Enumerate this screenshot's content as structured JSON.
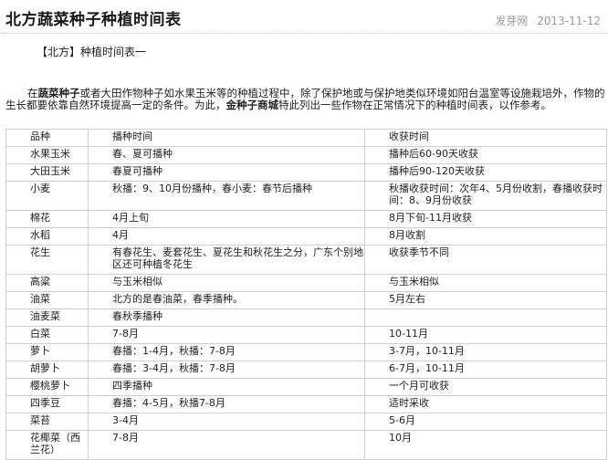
{
  "article": {
    "title": "北方蔬菜种子种植时间表",
    "source": "发芽网",
    "date": "2013-11-12",
    "subheading": "【北方】种植时间表一",
    "intro": {
      "p1": "在",
      "b1": "蔬菜种子",
      "p2": "或者大田作物种子如水果玉米等的种植过程中，除了保护地或与保护地类似环境如阳台温室等设施栽培外，作物的生长都要依靠自然环境提高一定的条件。为此，",
      "b2": "金种子商城",
      "p3": "特此列出一些作物在正常情况下的种植时间表，以作参考。"
    }
  },
  "table": {
    "headers": [
      "品种",
      "播种时间",
      "收获时间"
    ],
    "rows": [
      [
        "水果玉米",
        "春、夏可播种",
        "播种后60-90天收获"
      ],
      [
        "大田玉米",
        "春夏可播种",
        "播种后90-120天收获"
      ],
      [
        "小麦",
        "秋播：9、10月份播种，春小麦：春节后播种",
        "秋播收获时间：次年4、5月份收割，春播收获时间：8、9月份收获"
      ],
      [
        "棉花",
        "4月上旬",
        "8月下旬-11月收获"
      ],
      [
        "水稻",
        "4月",
        "8月收割"
      ],
      [
        "花生",
        "有春花生、麦套花生、夏花生和秋花生之分，广东个别地区还可种植冬花生",
        "收获季节不同"
      ],
      [
        "高粱",
        "与玉米相似",
        "与玉米相似"
      ],
      [
        "油菜",
        "北方的是春油菜，春季播种。",
        "5月左右"
      ],
      [
        "油麦菜",
        "春秋季播种",
        ""
      ],
      [
        "白菜",
        "7-8月",
        "10-11月"
      ],
      [
        "萝卜",
        "春播：1-4月，秋播：7-8月",
        "3-7月，10-11月"
      ],
      [
        "胡萝卜",
        "春播：3-4月，秋播：7-8月",
        "6-7月，10-11月"
      ],
      [
        "樱桃萝卜",
        "四季播种",
        "一个月可收获"
      ],
      [
        "四季豆",
        "春播：4-5月，秋播7-8月",
        "适时采收"
      ],
      [
        "菜苔",
        "3-4月",
        "5-6月"
      ],
      [
        "花椰菜（西兰花）",
        "7-8月",
        "10月"
      ]
    ]
  }
}
